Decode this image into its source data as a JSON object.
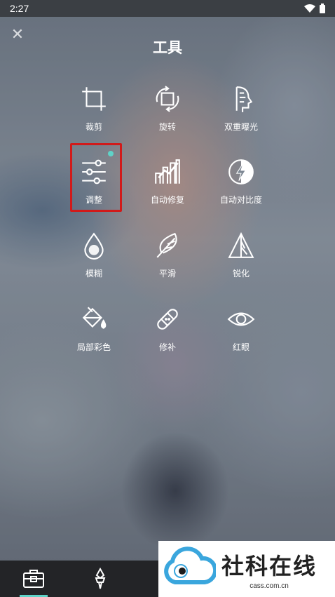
{
  "status_bar": {
    "time": "2:27"
  },
  "header": {
    "title": "工具"
  },
  "tools": [
    {
      "label": "裁剪",
      "icon": "crop-icon"
    },
    {
      "label": "旋转",
      "icon": "rotate-icon"
    },
    {
      "label": "双重曝光",
      "icon": "double-exposure-icon"
    },
    {
      "label": "调整",
      "icon": "adjust-sliders-icon",
      "highlighted": true,
      "new_dot": true
    },
    {
      "label": "自动修复",
      "icon": "auto-fix-icon"
    },
    {
      "label": "自动对比度",
      "icon": "auto-contrast-icon"
    },
    {
      "label": "模糊",
      "icon": "blur-icon"
    },
    {
      "label": "平滑",
      "icon": "smooth-feather-icon"
    },
    {
      "label": "锐化",
      "icon": "sharpen-icon"
    },
    {
      "label": "局部彩色",
      "icon": "color-splash-icon"
    },
    {
      "label": "修补",
      "icon": "patch-bandage-icon"
    },
    {
      "label": "红眼",
      "icon": "red-eye-icon"
    }
  ],
  "bottom_bar": {
    "items": [
      "tools-icon",
      "brush-icon"
    ],
    "active_index": 0
  },
  "watermark": {
    "title": "社科在线",
    "subtitle": "cass.com.cn"
  },
  "colors": {
    "accent": "#5fd3c8",
    "highlight_border": "#d11a1a",
    "bar": "#232427"
  }
}
